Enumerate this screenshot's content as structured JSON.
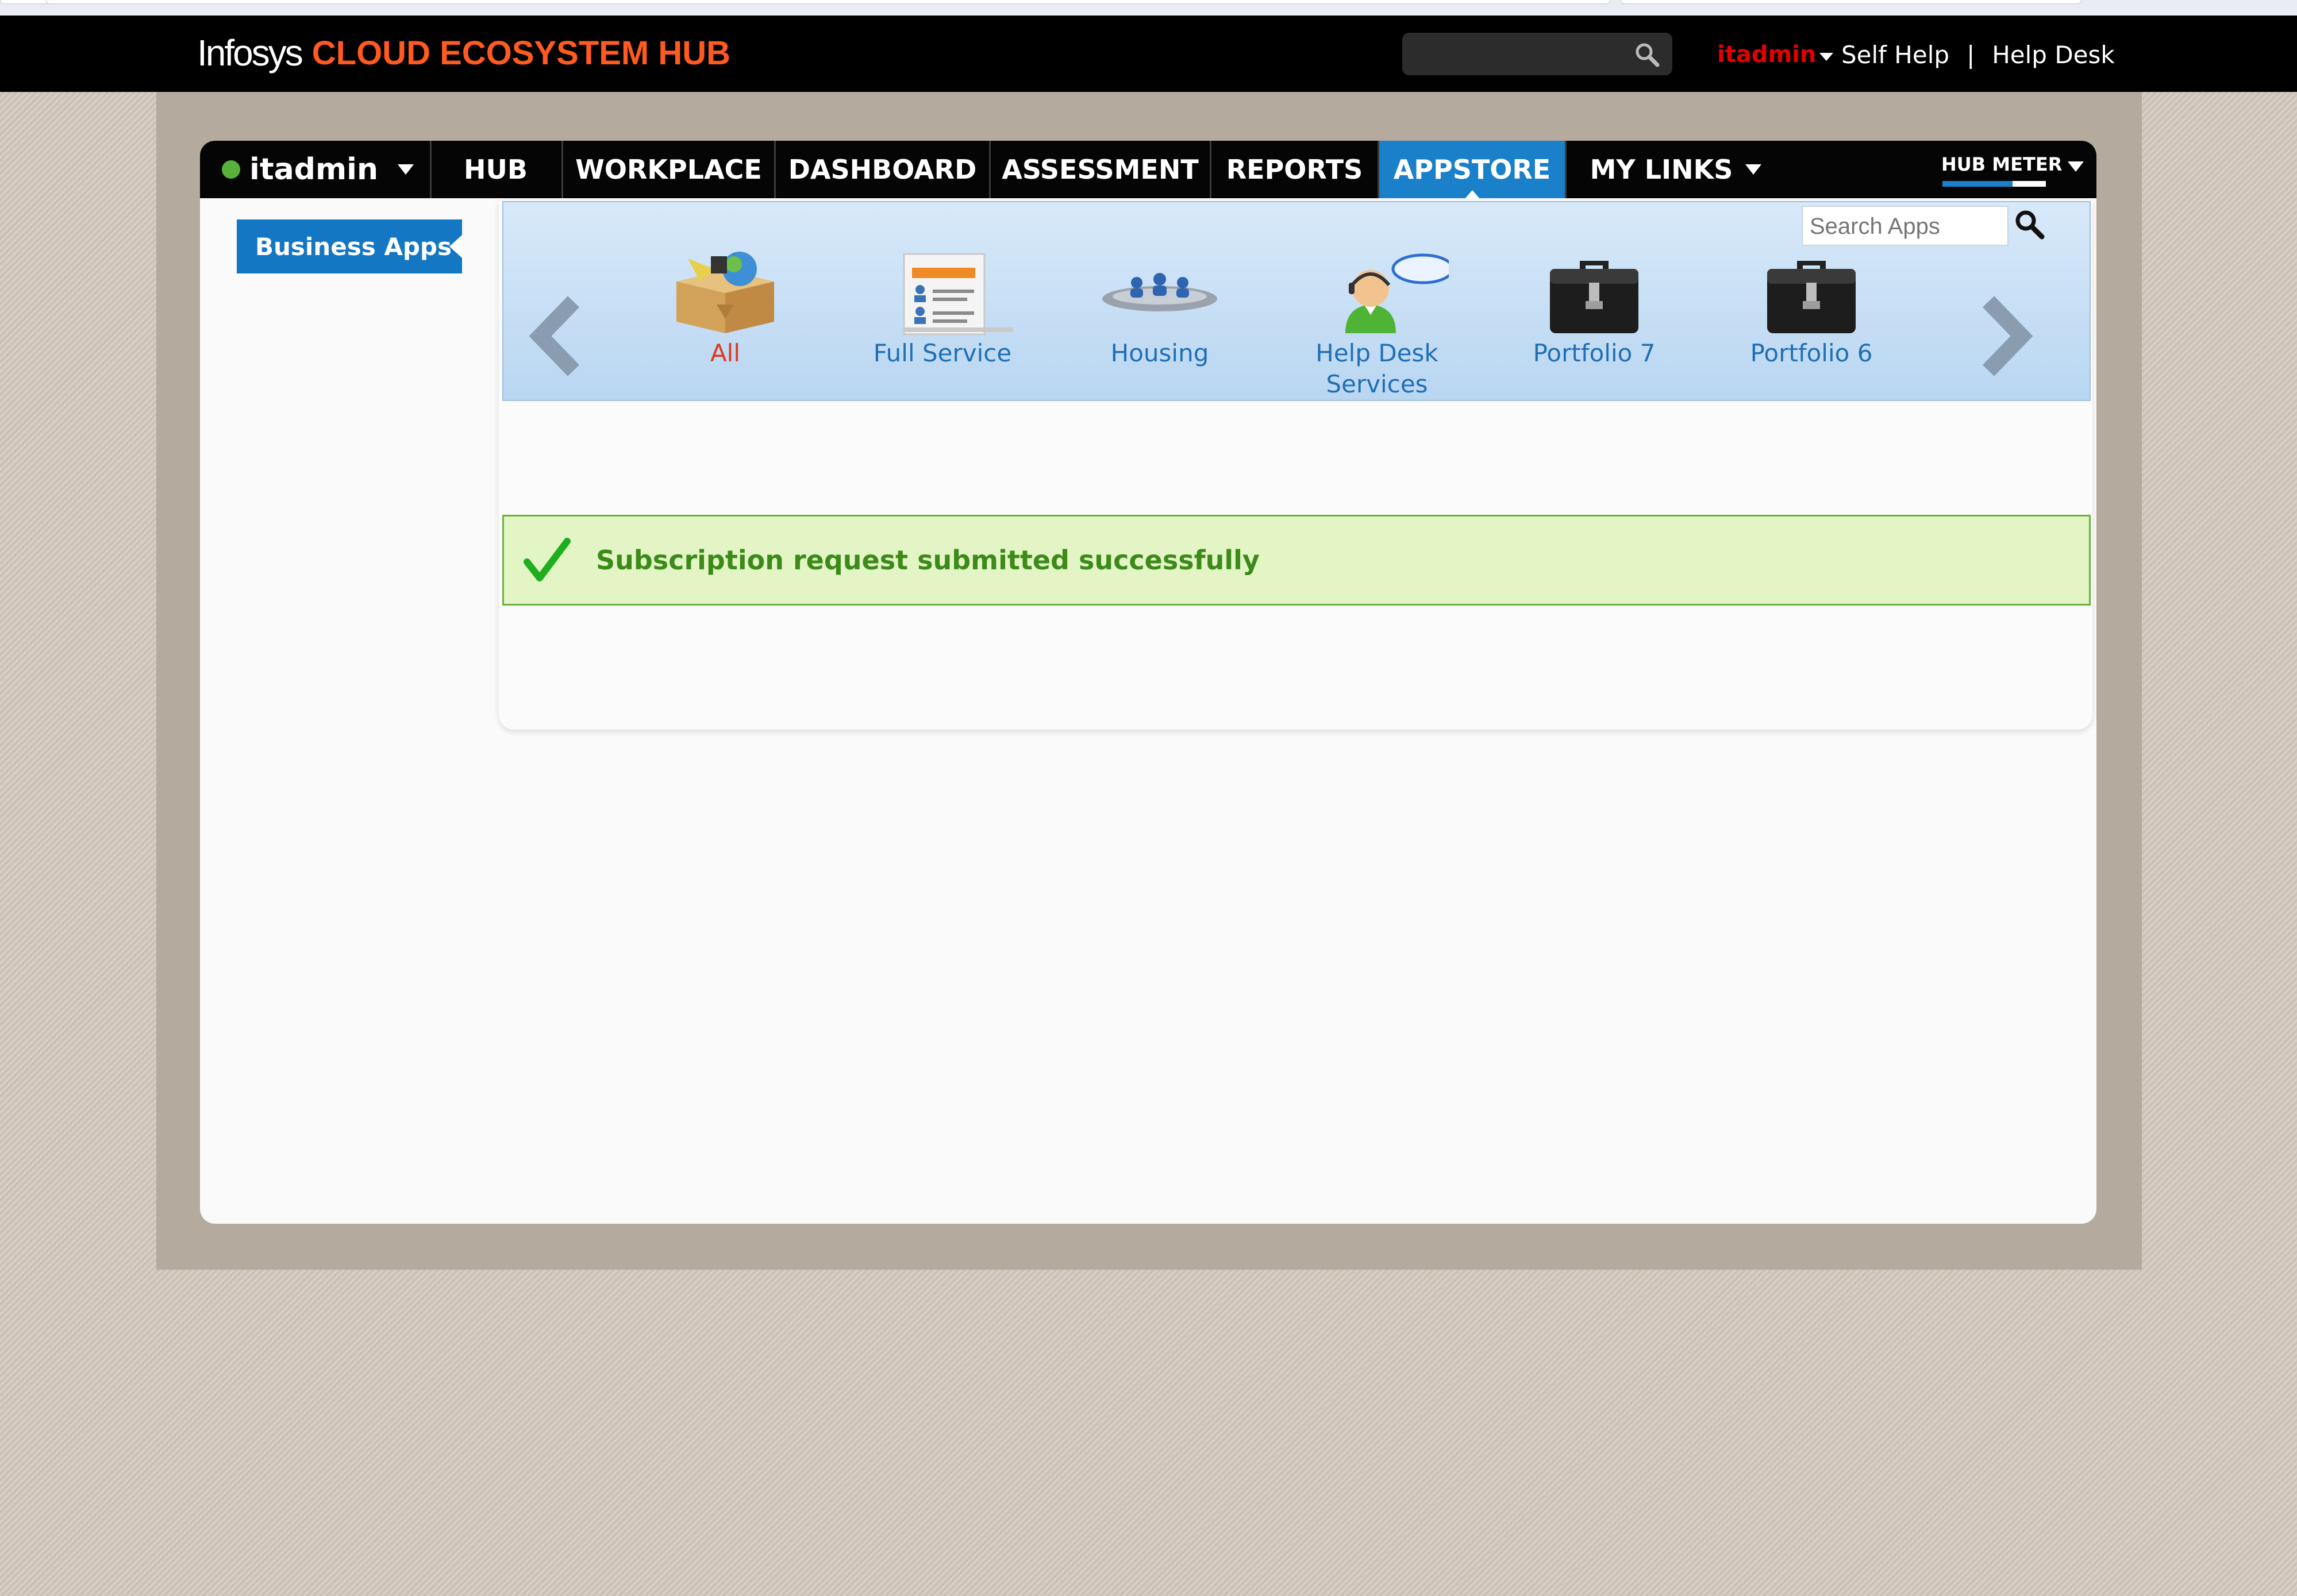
{
  "header": {
    "brand_infosys": "Infosys",
    "brand_title": "CLOUD ECOSYSTEM HUB",
    "search_value": "",
    "user": "itadmin",
    "links": [
      "Self Help",
      "Help Desk"
    ],
    "link_separator": "|"
  },
  "nav": {
    "user": "itadmin",
    "items": [
      {
        "label": "HUB"
      },
      {
        "label": "WORKPLACE"
      },
      {
        "label": "DASHBOARD"
      },
      {
        "label": "ASSESSMENT"
      },
      {
        "label": "REPORTS"
      },
      {
        "label": "APPSTORE",
        "active": true
      },
      {
        "label": "MY LINKS"
      }
    ],
    "hub_meter_label": "HUB METER",
    "hub_meter_fraction": 0.68
  },
  "sidebar": {
    "tab_label": "Business Apps"
  },
  "appstore": {
    "search_placeholder": "Search Apps",
    "apps": [
      {
        "label": "All",
        "icon": "box-icon",
        "active": true
      },
      {
        "label": "Full Service",
        "icon": "id-card-icon"
      },
      {
        "label": "Housing",
        "icon": "people-group-icon"
      },
      {
        "label": "Help Desk Services",
        "icon": "help-desk-icon"
      },
      {
        "label": "Portfolio 7",
        "icon": "briefcase-icon"
      },
      {
        "label": "Portfolio 6",
        "icon": "briefcase-icon"
      }
    ]
  },
  "message": {
    "text": "Subscription request submitted successfully",
    "type": "success"
  },
  "colors": {
    "accent": "#1a80c9",
    "brand_orange": "#ff5a1f",
    "success_bg": "#e3f5c4",
    "success_text": "#3c8a1a"
  }
}
